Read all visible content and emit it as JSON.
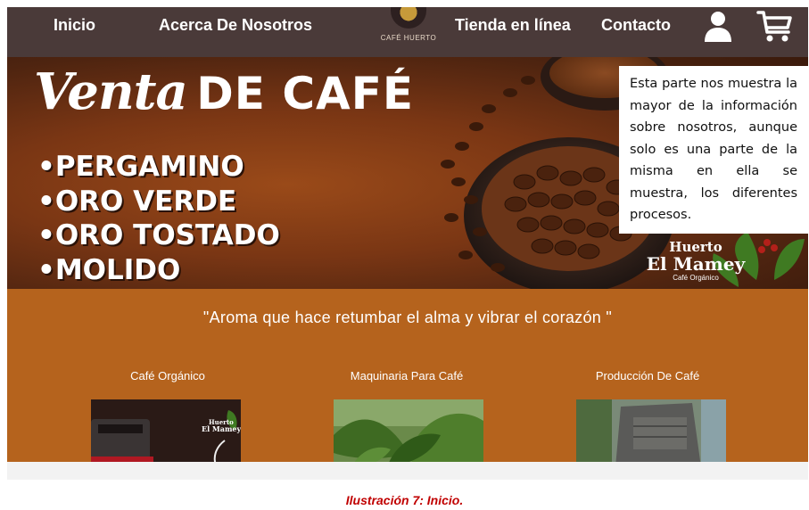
{
  "nav": {
    "inicio": "Inicio",
    "acerca": "Acerca De Nosotros",
    "logo_text": "CAFÉ HUERTO",
    "tienda": "Tienda en línea",
    "contacto": "Contacto",
    "user_icon": "user-icon",
    "cart_icon": "shopping-cart-icon"
  },
  "hero": {
    "title_script": "Venta",
    "title_caps": "DE CAFÉ",
    "items": [
      "•PERGAMINO",
      "•ORO VERDE",
      "•ORO TOSTADO",
      "•MOLIDO"
    ],
    "brand": {
      "huerto": "Huerto",
      "mamey": "El Mamey",
      "sub": "Café Orgánico"
    }
  },
  "callout": {
    "text": "Esta parte nos muestra la mayor de la información sobre nosotros, aunque solo es una parte de la misma en ella se muestra, los diferentes procesos."
  },
  "section": {
    "slogan": "\"Aroma que hace retumbar el alma y vibrar el corazón \"",
    "categories": [
      {
        "label": "Café Orgánico",
        "brand_huerto": "Huerto",
        "brand_mamey": "El Mamey"
      },
      {
        "label": "Maquinaria Para Café"
      },
      {
        "label": "Producción De Café"
      }
    ]
  },
  "caption": "Ilustración 7: Inicio.",
  "colors": {
    "nav_bg": "#4a3a39",
    "section_bg": "#b5631d",
    "caption": "#c00000"
  }
}
